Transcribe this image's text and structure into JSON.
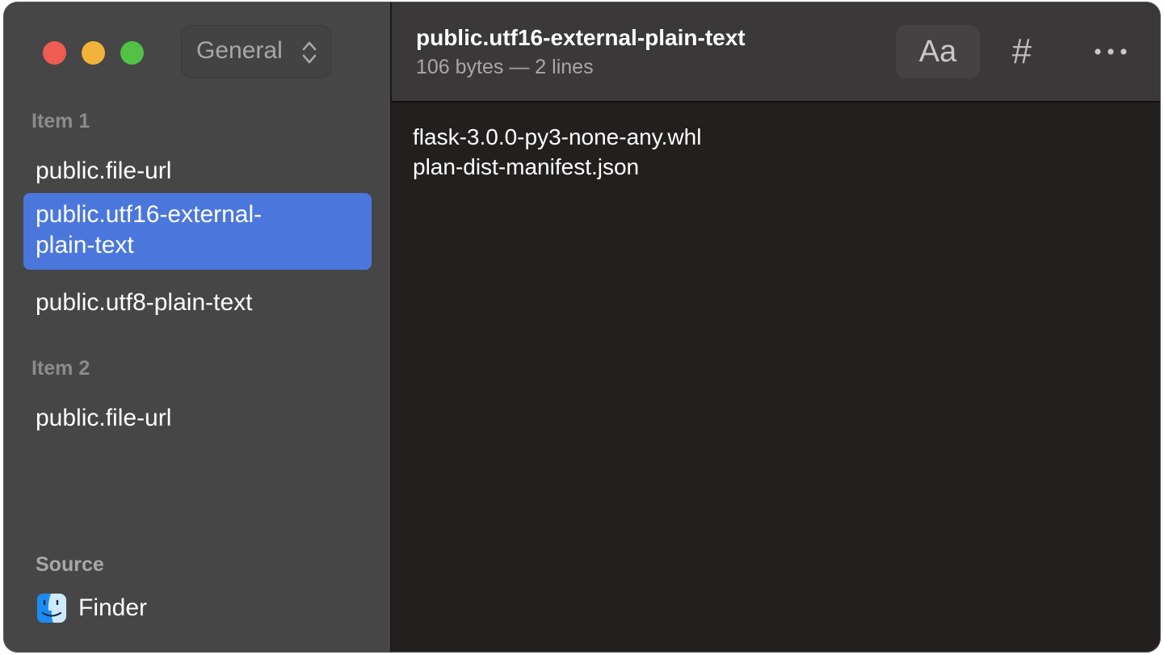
{
  "window": {
    "view_select": {
      "value": "General"
    }
  },
  "sidebar": {
    "sections": [
      {
        "title": "Item 1",
        "items": [
          {
            "label": "public.file-url",
            "selected": false
          },
          {
            "label": "public.utf16-external-plain-text",
            "display_line1": "public.utf16-external-",
            "display_line2": "plain-text",
            "selected": true
          },
          {
            "label": "public.utf8-plain-text",
            "selected": false
          }
        ]
      },
      {
        "title": "Item 2",
        "items": [
          {
            "label": "public.file-url",
            "selected": false
          }
        ]
      }
    ],
    "source": {
      "title": "Source",
      "app": "Finder",
      "icon": "finder-icon"
    }
  },
  "header": {
    "title": "public.utf16-external-plain-text",
    "subtitle": "106 bytes — 2 lines",
    "buttons": {
      "font_label": "Aa",
      "hash_label": "#",
      "more_icon": "ellipsis-icon"
    }
  },
  "content": {
    "lines": [
      "flask-3.0.0-py3-none-any.whl",
      "plan-dist-manifest.json"
    ]
  },
  "colors": {
    "selection": "#4b77dc",
    "close": "#ee5c52",
    "minimize": "#f2b33b",
    "maximize": "#52c145"
  }
}
